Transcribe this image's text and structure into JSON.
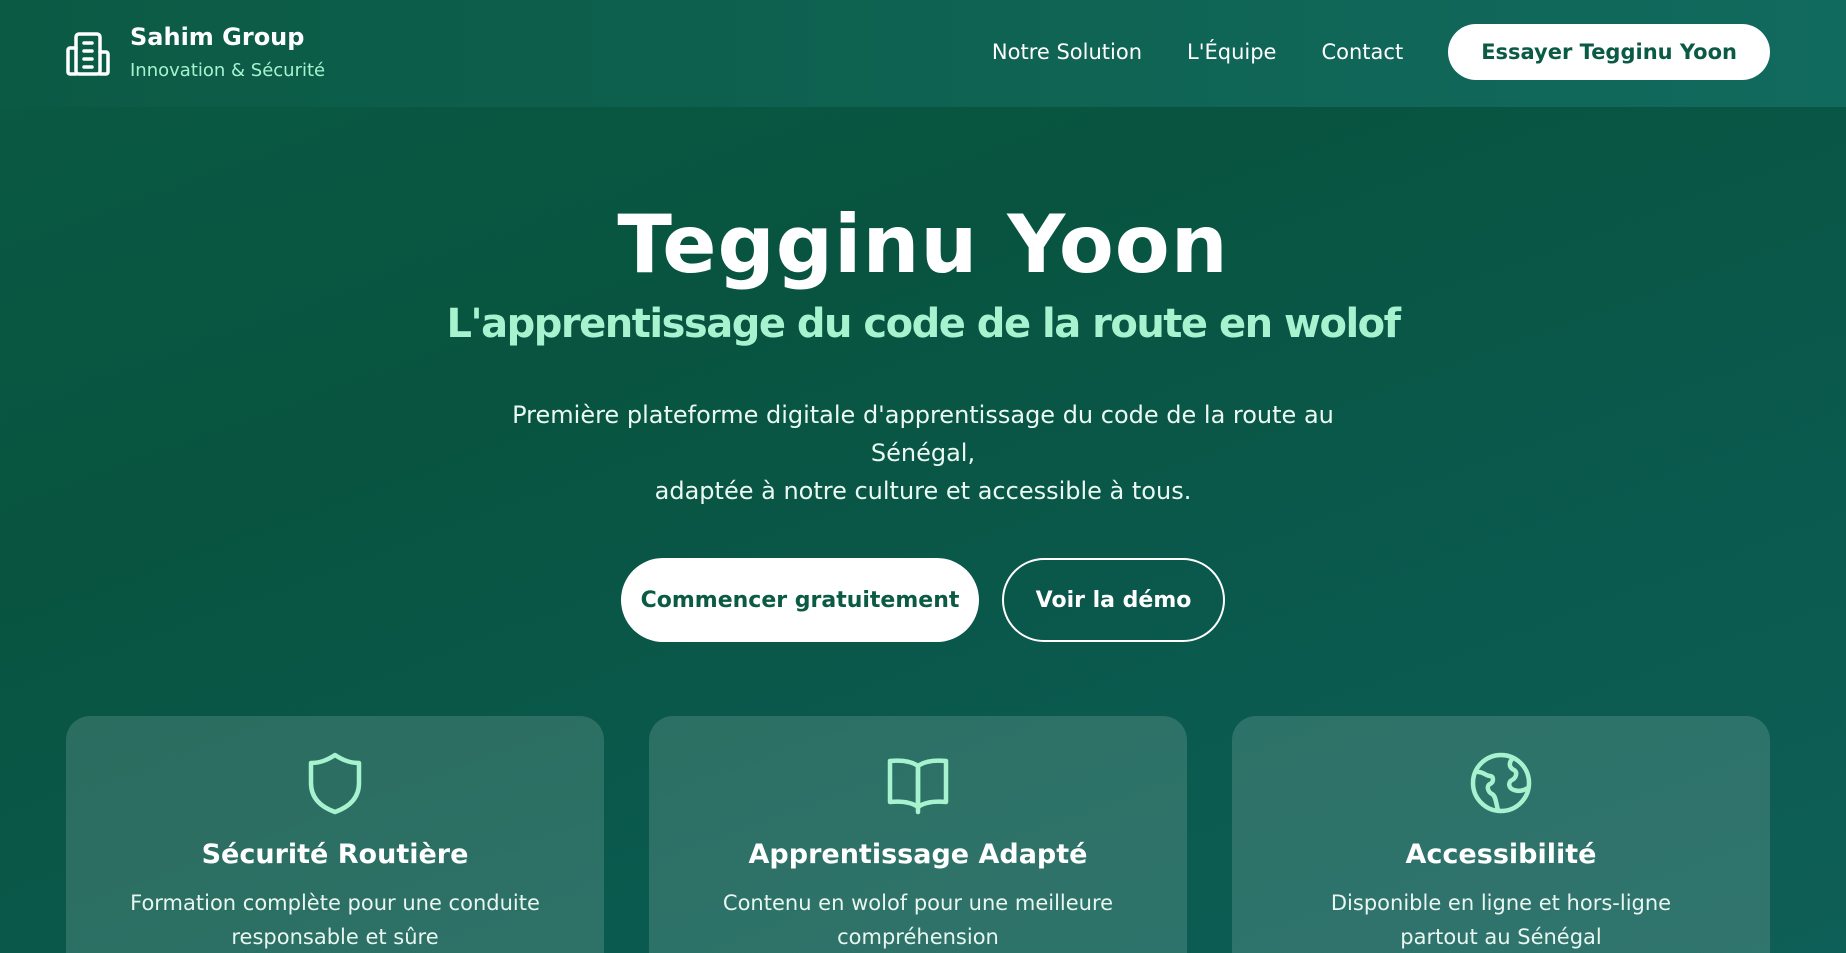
{
  "header": {
    "brand_name": "Sahim Group",
    "brand_tagline": "Innovation & Sécurité",
    "brand_icon": "building-icon",
    "nav": [
      {
        "label": "Notre Solution"
      },
      {
        "label": "L'Équipe"
      },
      {
        "label": "Contact"
      }
    ],
    "cta_label": "Essayer Tegginu Yoon"
  },
  "hero": {
    "title": "Tegginu Yoon",
    "subtitle": "L'apprentissage du code de la route en wolof",
    "description_line1": "Première plateforme digitale d'apprentissage du code de la route au Sénégal,",
    "description_line2": "adaptée à notre culture et accessible à tous.",
    "primary_button": "Commencer gratuitement",
    "secondary_button": "Voir la démo"
  },
  "features": [
    {
      "icon": "shield-icon",
      "title": "Sécurité Routière",
      "description": "Formation complète pour une conduite responsable et sûre"
    },
    {
      "icon": "book-open-icon",
      "title": "Apprentissage Adapté",
      "description": "Contenu en wolof pour une meilleure compréhension"
    },
    {
      "icon": "globe-icon",
      "title": "Accessibilité",
      "description": "Disponible en ligne et hors-ligne partout au Sénégal"
    }
  ],
  "colors": {
    "primary_green": "#0a5a44",
    "accent_mint": "#a7f3d0",
    "white": "#ffffff"
  }
}
